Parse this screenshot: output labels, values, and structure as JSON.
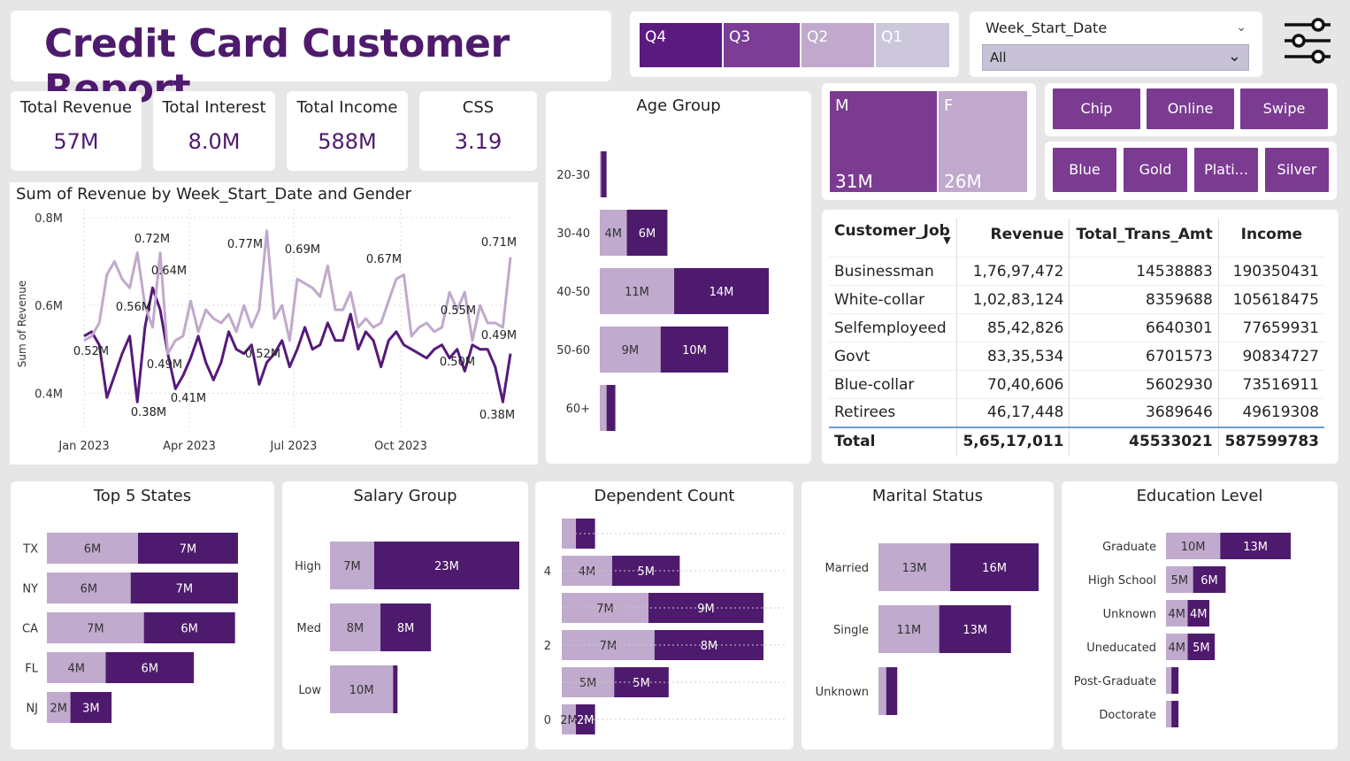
{
  "header": {
    "title": "Credit Card Customer Report"
  },
  "quarters": [
    {
      "label": "Q4",
      "color": "#5b1a80"
    },
    {
      "label": "Q3",
      "color": "#7b3d96"
    },
    {
      "label": "Q2",
      "color": "#c0a9cc"
    },
    {
      "label": "Q1",
      "color": "#cdc7dc"
    }
  ],
  "week_filter": {
    "label": "Week_Start_Date",
    "value": "All"
  },
  "kpis": [
    {
      "label": "Total Revenue",
      "value": "57M"
    },
    {
      "label": "Total Interest",
      "value": "8.0M"
    },
    {
      "label": "Total Income",
      "value": "588M"
    },
    {
      "label": "CSS",
      "value": "3.19"
    }
  ],
  "colors": {
    "dark": "#4e1a6d",
    "light": "#c0aacd",
    "accent": "#7a3b91"
  },
  "gender": [
    {
      "label": "M",
      "value": "31M",
      "color": "#7a3b91"
    },
    {
      "label": "F",
      "value": "26M",
      "color": "#c0a9cc"
    }
  ],
  "card_type_buttons": [
    "Chip",
    "Online",
    "Swipe"
  ],
  "card_category_buttons": [
    "Blue",
    "Gold",
    "Plati...",
    "Silver"
  ],
  "jobs_table": {
    "headers": [
      "Customer_Job",
      "Revenue",
      "Total_Trans_Amt",
      "Income"
    ],
    "rows": [
      [
        "Businessman",
        "1,76,97,472",
        "14538883",
        "190350431"
      ],
      [
        "White-collar",
        "1,02,83,124",
        "8359688",
        "105618475"
      ],
      [
        "Selfemployeed",
        "85,42,826",
        "6640301",
        "77659931"
      ],
      [
        "Govt",
        "83,35,534",
        "6701573",
        "90834727"
      ],
      [
        "Blue-collar",
        "70,40,606",
        "5602930",
        "73516911"
      ],
      [
        "Retirees",
        "46,17,448",
        "3689646",
        "49619308"
      ]
    ],
    "total": [
      "Total",
      "5,65,17,011",
      "45533021",
      "587599783"
    ]
  },
  "chart_data": [
    {
      "type": "line",
      "title": "Sum of Revenue by Week_Start_Date and Gender",
      "ylabel": "Sum of Revenue",
      "yticks": [
        "0.4M",
        "0.6M",
        "0.8M"
      ],
      "xticks": [
        "Jan 2023",
        "Apr 2023",
        "Jul 2023",
        "Oct 2023"
      ],
      "ylim": [
        0.32,
        0.82
      ],
      "series": [
        {
          "values": [
            0.52,
            0.53,
            0.56,
            0.67,
            0.7,
            0.66,
            0.64,
            0.72,
            0.6,
            0.55,
            0.72,
            0.49,
            0.52,
            0.53,
            0.61,
            0.54,
            0.59,
            0.57,
            0.56,
            0.58,
            0.54,
            0.6,
            0.55,
            0.59,
            0.77,
            0.57,
            0.6,
            0.52,
            0.66,
            0.65,
            0.64,
            0.62,
            0.69,
            0.59,
            0.59,
            0.63,
            0.55,
            0.57,
            0.55,
            0.56,
            0.61,
            0.66,
            0.67,
            0.53,
            0.55,
            0.56,
            0.54,
            0.55,
            0.63,
            0.59,
            0.63,
            0.52,
            0.6,
            0.56,
            0.56,
            0.55,
            0.71
          ]
        },
        {
          "values": [
            0.53,
            0.54,
            0.51,
            0.39,
            0.44,
            0.49,
            0.53,
            0.38,
            0.55,
            0.64,
            0.59,
            0.49,
            0.41,
            0.44,
            0.48,
            0.53,
            0.47,
            0.43,
            0.47,
            0.54,
            0.5,
            0.49,
            0.51,
            0.42,
            0.47,
            0.49,
            0.52,
            0.46,
            0.5,
            0.55,
            0.5,
            0.51,
            0.56,
            0.52,
            0.52,
            0.58,
            0.5,
            0.54,
            0.52,
            0.46,
            0.52,
            0.54,
            0.51,
            0.5,
            0.49,
            0.48,
            0.5,
            0.51,
            0.48,
            0.5,
            0.45,
            0.51,
            0.5,
            0.5,
            0.46,
            0.38,
            0.49
          ]
        }
      ],
      "data_labels": [
        "0.72M",
        "0.64M",
        "0.56M",
        "0.52M",
        "0.49M",
        "0.38M",
        "0.41M",
        "0.77M",
        "0.52M",
        "0.69M",
        "0.67M",
        "0.55M",
        "0.50M",
        "0.71M",
        "0.49M",
        "0.38M"
      ]
    },
    {
      "type": "bar",
      "title": "Age Group",
      "categories": [
        "20-30",
        "30-40",
        "40-50",
        "50-60",
        "60+"
      ],
      "series": [
        {
          "values": [
            0.2,
            4,
            11,
            9,
            1
          ],
          "labels": [
            "",
            "4M",
            "11M",
            "9M",
            ""
          ]
        },
        {
          "values": [
            0.8,
            6,
            14,
            10,
            1.3
          ],
          "labels": [
            "",
            "6M",
            "14M",
            "10M",
            ""
          ]
        }
      ]
    },
    {
      "type": "bar",
      "title": "Top 5 States",
      "categories": [
        "TX",
        "NY",
        "CA",
        "FL",
        "NJ"
      ],
      "series": [
        {
          "values": [
            6.2,
            5.7,
            6.6,
            4.0,
            1.6
          ],
          "labels": [
            "6M",
            "6M",
            "7M",
            "4M",
            "2M"
          ]
        },
        {
          "values": [
            6.8,
            7.3,
            6.2,
            6.0,
            2.8
          ],
          "labels": [
            "7M",
            "7M",
            "6M",
            "6M",
            "3M"
          ]
        }
      ]
    },
    {
      "type": "bar",
      "title": "Salary Group",
      "categories": [
        "High",
        "Med",
        "Low"
      ],
      "series": [
        {
          "values": [
            7,
            8,
            10
          ],
          "labels": [
            "7M",
            "8M",
            "10M"
          ]
        },
        {
          "values": [
            23,
            8,
            0.7
          ],
          "labels": [
            "23M",
            "8M",
            ""
          ]
        }
      ]
    },
    {
      "type": "bar",
      "title": "Dependent Count",
      "yticks": [
        "4",
        "2",
        "0"
      ],
      "series": [
        {
          "values": [
            1.4,
            5,
            8.6,
            9.2,
            5.2,
            1.4
          ],
          "labels": [
            "",
            "4M",
            "7M",
            "7M",
            "5M",
            "2M"
          ]
        },
        {
          "values": [
            1.9,
            6.7,
            11.4,
            10.8,
            5.4,
            1.9
          ],
          "labels": [
            "",
            "5M",
            "9M",
            "8M",
            "5M",
            "2M"
          ]
        }
      ]
    },
    {
      "type": "bar",
      "title": "Marital Status",
      "categories": [
        "Married",
        "Single",
        "Unknown"
      ],
      "series": [
        {
          "values": [
            13,
            11,
            1.4
          ],
          "labels": [
            "13M",
            "11M",
            ""
          ]
        },
        {
          "values": [
            16,
            13,
            2.0
          ],
          "labels": [
            "16M",
            "13M",
            ""
          ]
        }
      ]
    },
    {
      "type": "bar",
      "title": "Education Level",
      "categories": [
        "Graduate",
        "High School",
        "Unknown",
        "Uneducated",
        "Post-Graduate",
        "Doctorate"
      ],
      "series": [
        {
          "values": [
            10,
            5,
            4,
            4,
            1,
            1
          ],
          "labels": [
            "10M",
            "5M",
            "4M",
            "4M",
            "",
            ""
          ]
        },
        {
          "values": [
            13,
            6,
            4,
            5,
            1.3,
            1.3
          ],
          "labels": [
            "13M",
            "6M",
            "4M",
            "5M",
            "",
            ""
          ]
        }
      ]
    }
  ]
}
